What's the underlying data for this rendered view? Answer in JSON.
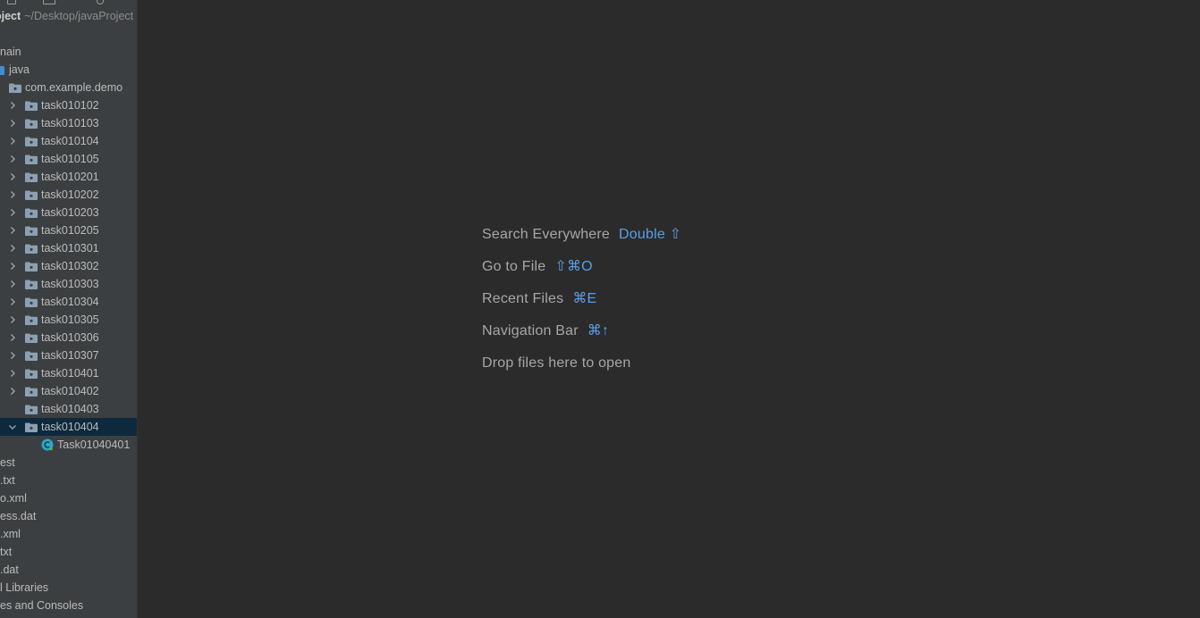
{
  "project": {
    "name": "oject",
    "path": "~/Desktop/javaProject"
  },
  "tree": [
    {
      "label": "nain",
      "depth": -1,
      "icon": "none",
      "chevron": "none"
    },
    {
      "label": "java",
      "depth": -1,
      "icon": "source-root-folder-icon",
      "chevron": "none"
    },
    {
      "label": "com.example.demo",
      "depth": 0,
      "icon": "package-folder-icon",
      "chevron": "none"
    },
    {
      "label": "task010102",
      "depth": 1,
      "icon": "package-folder-icon",
      "chevron": "right"
    },
    {
      "label": "task010103",
      "depth": 1,
      "icon": "package-folder-icon",
      "chevron": "right"
    },
    {
      "label": "task010104",
      "depth": 1,
      "icon": "package-folder-icon",
      "chevron": "right"
    },
    {
      "label": "task010105",
      "depth": 1,
      "icon": "package-folder-icon",
      "chevron": "right"
    },
    {
      "label": "task010201",
      "depth": 1,
      "icon": "package-folder-icon",
      "chevron": "right"
    },
    {
      "label": "task010202",
      "depth": 1,
      "icon": "package-folder-icon",
      "chevron": "right"
    },
    {
      "label": "task010203",
      "depth": 1,
      "icon": "package-folder-icon",
      "chevron": "right"
    },
    {
      "label": "task010205",
      "depth": 1,
      "icon": "package-folder-icon",
      "chevron": "right"
    },
    {
      "label": "task010301",
      "depth": 1,
      "icon": "package-folder-icon",
      "chevron": "right"
    },
    {
      "label": "task010302",
      "depth": 1,
      "icon": "package-folder-icon",
      "chevron": "right"
    },
    {
      "label": "task010303",
      "depth": 1,
      "icon": "package-folder-icon",
      "chevron": "right"
    },
    {
      "label": "task010304",
      "depth": 1,
      "icon": "package-folder-icon",
      "chevron": "right"
    },
    {
      "label": "task010305",
      "depth": 1,
      "icon": "package-folder-icon",
      "chevron": "right"
    },
    {
      "label": "task010306",
      "depth": 1,
      "icon": "package-folder-icon",
      "chevron": "right"
    },
    {
      "label": "task010307",
      "depth": 1,
      "icon": "package-folder-icon",
      "chevron": "right"
    },
    {
      "label": "task010401",
      "depth": 1,
      "icon": "package-folder-icon",
      "chevron": "right"
    },
    {
      "label": "task010402",
      "depth": 1,
      "icon": "package-folder-icon",
      "chevron": "right"
    },
    {
      "label": "task010403",
      "depth": 1,
      "icon": "package-folder-icon",
      "chevron": "none"
    },
    {
      "label": "task010404",
      "depth": 1,
      "icon": "package-folder-icon",
      "chevron": "down",
      "selected": true
    },
    {
      "label": "Task01040401",
      "depth": 2,
      "icon": "java-class-icon",
      "chevron": "none"
    },
    {
      "label": "est",
      "depth": -1,
      "icon": "none",
      "chevron": "none"
    },
    {
      "label": ".txt",
      "depth": -1,
      "icon": "none",
      "chevron": "none"
    },
    {
      "label": "o.xml",
      "depth": -1,
      "icon": "none",
      "chevron": "none"
    },
    {
      "label": "ess.dat",
      "depth": -1,
      "icon": "none",
      "chevron": "none"
    },
    {
      "label": ".xml",
      "depth": -1,
      "icon": "none",
      "chevron": "none"
    },
    {
      "label": "txt",
      "depth": -1,
      "icon": "none",
      "chevron": "none"
    },
    {
      "label": ".dat",
      "depth": -1,
      "icon": "none",
      "chevron": "none"
    },
    {
      "label": "l Libraries",
      "depth": -1,
      "icon": "none",
      "chevron": "none"
    },
    {
      "label": "es and Consoles",
      "depth": -1,
      "icon": "none",
      "chevron": "none"
    }
  ],
  "editor_hints": [
    {
      "text": "Search Everywhere",
      "shortcut": "Double ⇧"
    },
    {
      "text": "Go to File",
      "shortcut": "⇧⌘O"
    },
    {
      "text": "Recent Files",
      "shortcut": "⌘E"
    },
    {
      "text": "Navigation Bar",
      "shortcut": "⌘↑"
    },
    {
      "text": "Drop files here to open",
      "shortcut": ""
    }
  ],
  "colors": {
    "sidebar_bg": "#3c3f41",
    "editor_bg": "#2b2b2b",
    "selection_bg": "#0d293e",
    "folder_icon": "#8ba0b3",
    "source_root_icon": "#3d8fd1",
    "class_icon": "#2ca7c9",
    "shortcut_blue": "#5a9fe8"
  }
}
